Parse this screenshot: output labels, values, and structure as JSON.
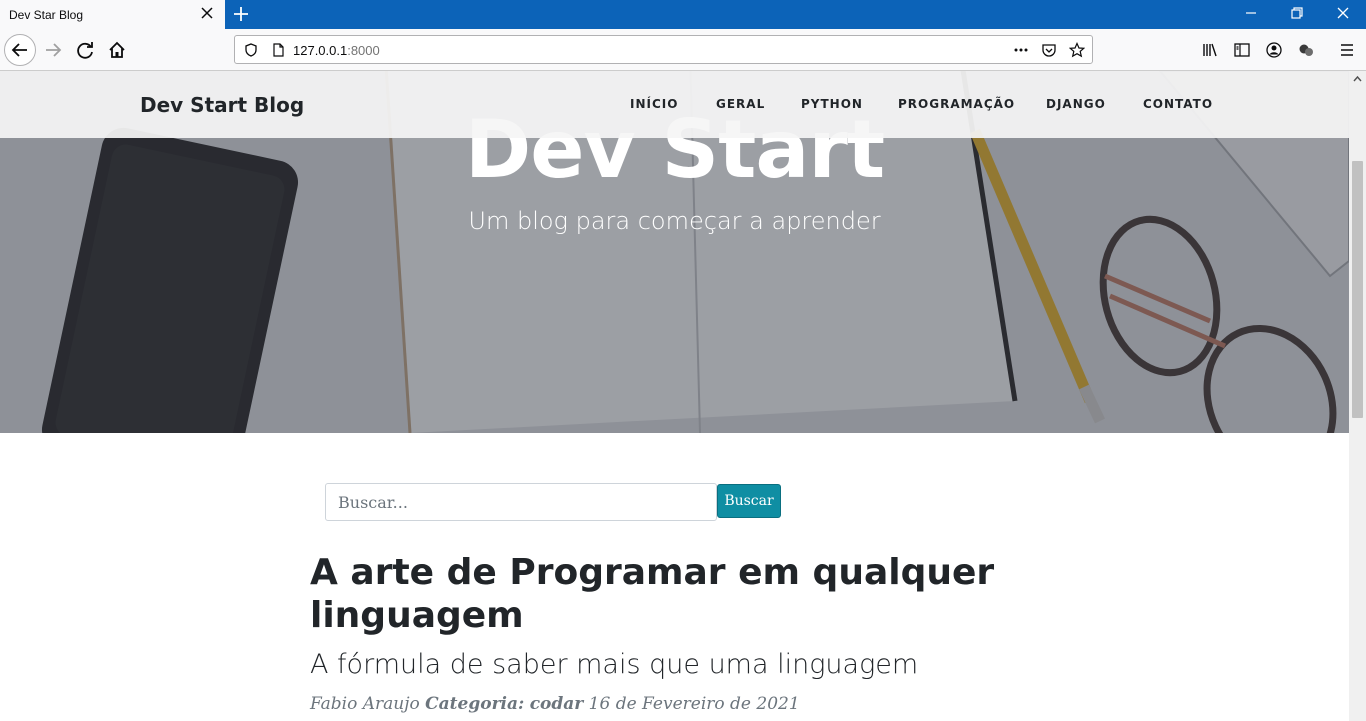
{
  "browser": {
    "tab_title": "Dev Star Blog",
    "url_host": "127.0.0.1",
    "url_port": ":8000"
  },
  "site": {
    "brand": "Dev Start Blog",
    "nav": [
      "INÍCIO",
      "GERAL",
      "PYTHON",
      "PROGRAMAÇÃO",
      "DJANGO",
      "CONTATO"
    ]
  },
  "hero": {
    "title": "Dev Start",
    "subtitle": "Um blog para começar a aprender"
  },
  "search": {
    "placeholder": "Buscar...",
    "button": "Buscar"
  },
  "post": {
    "title": "A arte de Programar em qualquer linguagem",
    "subtitle": "A fórmula de saber mais que uma linguagem",
    "author": "Fabio Araujo",
    "category_label": "Categoria:",
    "category": "codar",
    "date": "16 de Fevereiro de 2021"
  },
  "colors": {
    "tabbar": "#0c63b8",
    "button": "#0f8ea3"
  }
}
